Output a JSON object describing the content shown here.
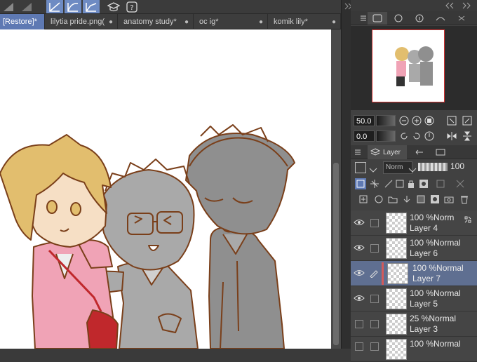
{
  "toolbar": {
    "buttons": [
      {
        "icon": "brush-tip-icon"
      },
      {
        "icon": "line-tool-icon"
      },
      {
        "icon": "curve-tool-icon"
      },
      {
        "icon": "polyline-tool-icon"
      },
      {
        "icon": "graduation-cap-icon"
      },
      {
        "icon": "help-icon"
      }
    ]
  },
  "document_tabs": [
    {
      "label": "[Restore]*",
      "active": true
    },
    {
      "label": "lilytia pride.png(",
      "active": false
    },
    {
      "label": "anatomy study*",
      "active": false
    },
    {
      "label": "oc ig*",
      "active": false
    },
    {
      "label": "komik lily*",
      "active": false
    }
  ],
  "panel": {
    "navigator": {
      "zoom_value": "50.0",
      "rotation_value": "0.0"
    },
    "layer_tab_label": "Layer",
    "blend_mode": "Norm",
    "opacity": "100",
    "layers": [
      {
        "mode": "100 %Norm",
        "name": "Layer 4",
        "visible": true,
        "selected": false
      },
      {
        "mode": "100 %Normal",
        "name": "Layer 6",
        "visible": true,
        "selected": false
      },
      {
        "mode": "100 %Normal",
        "name": "Layer 7",
        "visible": true,
        "selected": true
      },
      {
        "mode": "100 %Normal",
        "name": "Layer 5",
        "visible": true,
        "selected": false
      },
      {
        "mode": "25 %Normal",
        "name": "Layer 3",
        "visible": false,
        "selected": false
      },
      {
        "mode": "100 %Normal",
        "name": "",
        "visible": false,
        "selected": false
      }
    ]
  },
  "colors": {
    "accent": "#5e79b3",
    "selected_layer": "#5f6f91",
    "navigator_frame": "#d23232",
    "line_art": "#7a3f1a",
    "hair_blonde": "#e2be6e",
    "hoodie_pink": "#f0a3b6",
    "bag_red": "#c0282c",
    "gray_fill": "#a9a9a9",
    "dark_gray_fill": "#8f8f8f"
  }
}
